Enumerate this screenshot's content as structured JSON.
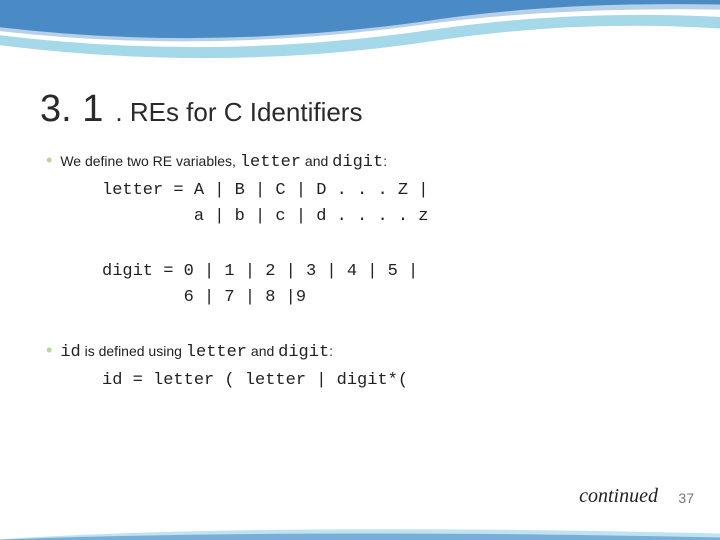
{
  "heading": {
    "number": "3. 1",
    "text": ". REs for C Identifiers"
  },
  "bullet1": {
    "pre": "We define two RE variables, ",
    "code1": "letter",
    "mid": " and ",
    "code2": "digit",
    "post": ":"
  },
  "letter_def": "letter = A | B | C | D . . . Z |\n         a | b | c | d . . . . z",
  "digit_def": "digit = 0 | 1 | 2 | 3 | 4 | 5 |\n        6 | 7 | 8 |9",
  "bullet2": {
    "code_left": "id",
    "mid1": "  is defined using ",
    "code1": "letter",
    "mid2": " and ",
    "code2": "digit",
    "post": ":"
  },
  "id_def": "id = letter ( letter | digit*(",
  "continued": "continued",
  "page": "37",
  "colors": {
    "swoosh_blue": "#4a8bc6",
    "swoosh_cyan": "#7fc8e0",
    "accent_green": "#b9d79a"
  }
}
